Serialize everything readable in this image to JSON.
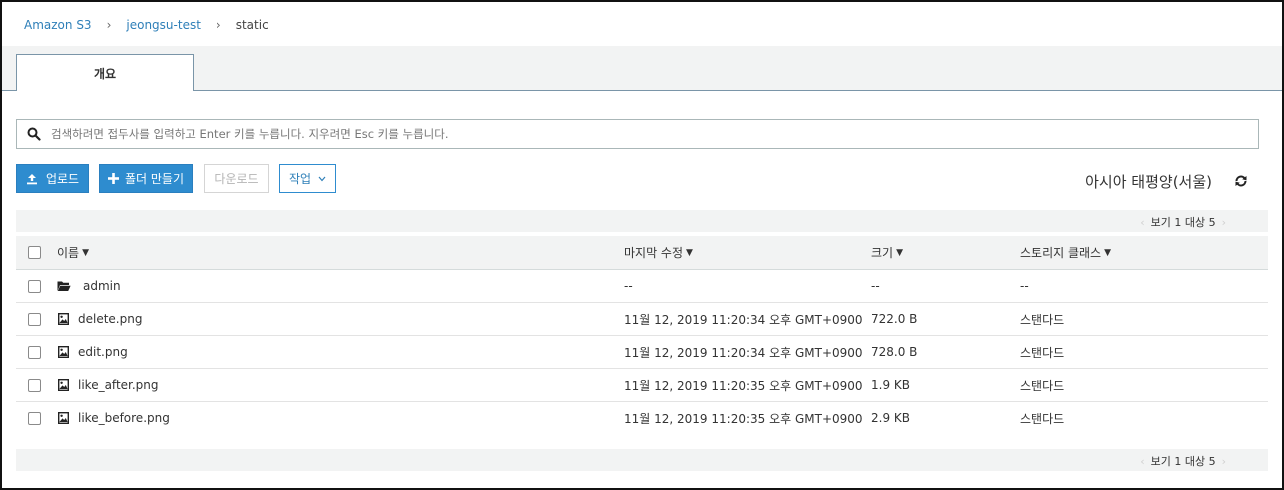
{
  "breadcrumb": {
    "items": [
      "Amazon S3",
      "jeongsu-test",
      "static"
    ],
    "separator": "›"
  },
  "tabs": [
    {
      "label": "개요",
      "active": true
    }
  ],
  "search": {
    "placeholder": "검색하려면 접두사를 입력하고 Enter 키를 누릅니다. 지우려면 Esc 키를 누릅니다.",
    "value": ""
  },
  "toolbar": {
    "upload_label": "업로드",
    "create_folder_label": "폴더 만들기",
    "download_label": "다운로드",
    "actions_label": "작업"
  },
  "region": "아시아 태평양(서울)",
  "pager": {
    "text": "보기 1 대상 5"
  },
  "table": {
    "columns": {
      "name": "이름",
      "modified": "마지막 수정",
      "size": "크기",
      "storage": "스토리지 클래스"
    },
    "rows": [
      {
        "type": "folder",
        "name": "admin",
        "modified": "--",
        "size": "--",
        "storage": "--"
      },
      {
        "type": "file",
        "name": "delete.png",
        "modified": "11월 12, 2019 11:20:34 오후 GMT+0900",
        "size": "722.0 B",
        "storage": "스탠다드"
      },
      {
        "type": "file",
        "name": "edit.png",
        "modified": "11월 12, 2019 11:20:34 오후 GMT+0900",
        "size": "728.0 B",
        "storage": "스탠다드"
      },
      {
        "type": "file",
        "name": "like_after.png",
        "modified": "11월 12, 2019 11:20:35 오후 GMT+0900",
        "size": "1.9 KB",
        "storage": "스탠다드"
      },
      {
        "type": "file",
        "name": "like_before.png",
        "modified": "11월 12, 2019 11:20:35 오후 GMT+0900",
        "size": "2.9 KB",
        "storage": "스탠다드"
      }
    ]
  },
  "colors": {
    "accent": "#2e8ccf",
    "link": "#2e7fb8",
    "header_bg": "#f2f3f3"
  }
}
